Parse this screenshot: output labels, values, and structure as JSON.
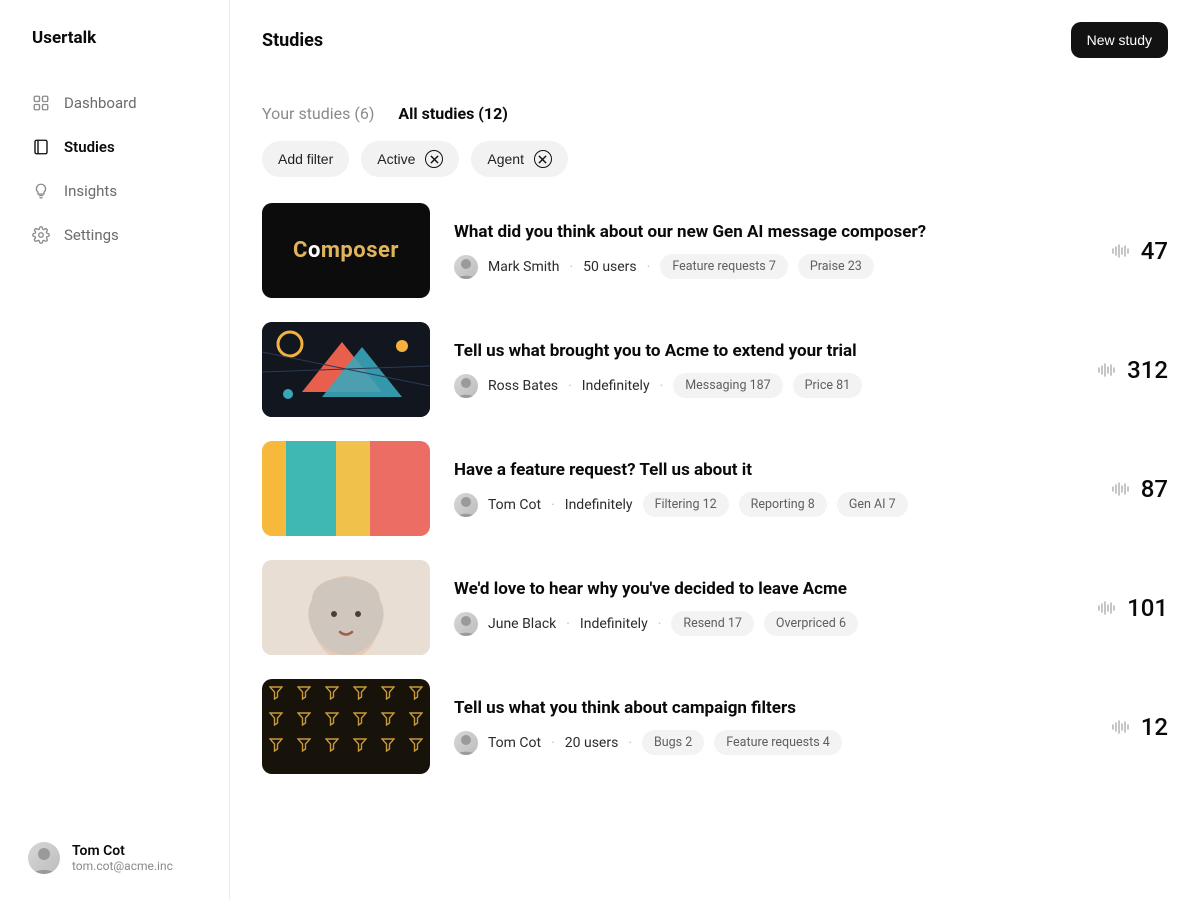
{
  "brand": "Usertalk",
  "nav": {
    "dashboard": "Dashboard",
    "studies": "Studies",
    "insights": "Insights",
    "settings": "Settings"
  },
  "user": {
    "name": "Tom Cot",
    "email": "tom.cot@acme.inc"
  },
  "header": {
    "title": "Studies",
    "newStudy": "New study"
  },
  "tabs": {
    "your": "Your studies (6)",
    "all": "All studies (12)"
  },
  "filters": {
    "addFilter": "Add filter",
    "active": "Active",
    "agent": "Agent"
  },
  "studies": [
    {
      "title": "What did you think about our new Gen AI message composer?",
      "author": "Mark Smith",
      "audience": "50 users",
      "tags": [
        "Feature requests 7",
        "Praise 23"
      ],
      "count": "47"
    },
    {
      "title": "Tell us what brought you to Acme to extend your trial",
      "author": "Ross Bates",
      "audience": "Indefinitely",
      "tags": [
        "Messaging 187",
        "Price 81"
      ],
      "count": "312"
    },
    {
      "title": "Have a feature request? Tell us about it",
      "author": "Tom Cot",
      "audience": "Indefinitely",
      "tags": [
        "Filtering 12",
        "Reporting 8",
        "Gen AI 7"
      ],
      "count": "87"
    },
    {
      "title": "We'd love to hear why you've decided to leave Acme",
      "author": "June Black",
      "audience": "Indefinitely",
      "tags": [
        "Resend 17",
        "Overpriced 6"
      ],
      "count": "101"
    },
    {
      "title": "Tell us what you think about campaign filters",
      "author": "Tom Cot",
      "audience": "20 users",
      "tags": [
        "Bugs 2",
        "Feature requests 4"
      ],
      "count": "12"
    }
  ]
}
